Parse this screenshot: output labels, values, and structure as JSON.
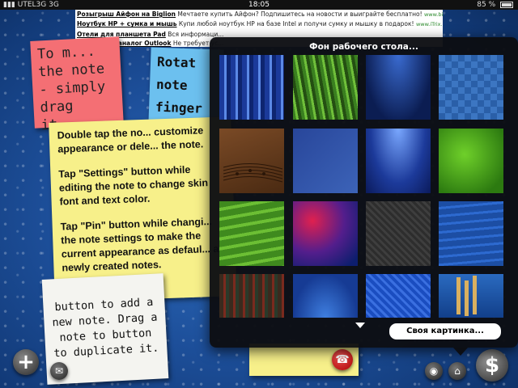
{
  "status_bar": {
    "carrier": "UTEL3G",
    "network": "3G",
    "time": "18:05",
    "battery": "85 %"
  },
  "ads": [
    {
      "title": "Розыгрыш Айфон на Biglion",
      "text": "Мечтаете купить Айфон? Подпишитесь на новости и выиграйте бесплатно!",
      "url": "www.biglion.ru"
    },
    {
      "title": "Ноутбук HP + сумка и мышь",
      "text": "Купи любой ноутбук HP на базе Intel и получи сумку и мышку в подарок!",
      "url": "www.iTrix.ua"
    },
    {
      "title": "Отели для планшета Pad",
      "text": "Вся информаци...",
      "url": ""
    },
    {
      "title": "Мегаплан - аналог Outlook",
      "text": "Не требует ус...",
      "url": ""
    }
  ],
  "notes": {
    "pink": "To m... the note - simply drag it...",
    "blue": "Rotat note finger",
    "yellow_p1": "Double tap the no... customize appearance or dele... the note.",
    "yellow_p2": "Tap \"Settings\" button while editing the note to change skin font and text color.",
    "yellow_p3": "Tap \"Pin\" button while changi... the note settings to make the current appearance as defaul... all newly created notes.",
    "white": "button to add a new note. Drag a note to button to duplicate it."
  },
  "popover": {
    "title": "Фон рабочего стола...",
    "own_picture_button": "Своя картинка..."
  },
  "wallpapers": [
    "blue-stripes",
    "green-grass",
    "blue-mesh",
    "blue-squares",
    "wood-music",
    "blue-gradient",
    "blue-rays",
    "green-bokeh",
    "green-waves",
    "red-blue-bokeh",
    "dark-carbon",
    "blue-wave-lines",
    "abstract-grid",
    "blue-radial",
    "blue-fabric",
    "blue-pencils"
  ],
  "icons": {
    "add": "+",
    "mail": "✉",
    "phone": "☎",
    "camera": "◉",
    "home": "⌂",
    "dollar": "$"
  }
}
